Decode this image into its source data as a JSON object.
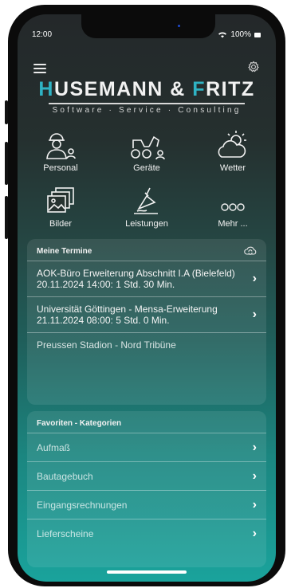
{
  "status": {
    "time": "12:00",
    "battery": "100%"
  },
  "logo": {
    "part1": "H",
    "part2": "USEMANN & ",
    "part3": "F",
    "part4": "RITZ",
    "tagline": "Software · Service · Consulting"
  },
  "tiles": [
    {
      "label": "Personal",
      "icon": "person-icon"
    },
    {
      "label": "Geräte",
      "icon": "excavator-icon"
    },
    {
      "label": "Wetter",
      "icon": "weather-icon"
    },
    {
      "label": "Bilder",
      "icon": "photos-icon"
    },
    {
      "label": "Leistungen",
      "icon": "trowel-icon"
    },
    {
      "label": "Mehr ...",
      "icon": "more-icon"
    }
  ],
  "appointments": {
    "title": "Meine Termine",
    "items": [
      {
        "title": "AOK-Büro Erweiterung Abschnitt I.A (Bielefeld)",
        "date": "20.11.2024 14:00: 1 Std. 30 Min."
      },
      {
        "title": "Universität Göttingen - Mensa-Erweiterung",
        "date": "21.11.2024 08:00: 5 Std. 0 Min."
      },
      {
        "title": "Preussen Stadion - Nord Tribüne",
        "date": ""
      }
    ]
  },
  "favorites": {
    "title": "Favoriten - Kategorien",
    "items": [
      {
        "label": "Aufmaß"
      },
      {
        "label": "Bautagebuch"
      },
      {
        "label": "Eingangsrechnungen"
      },
      {
        "label": "Lieferscheine"
      }
    ]
  },
  "colors": {
    "accent": "#2fb3c4",
    "gradient_top": "#24282a",
    "gradient_bottom": "#1aa39c"
  }
}
